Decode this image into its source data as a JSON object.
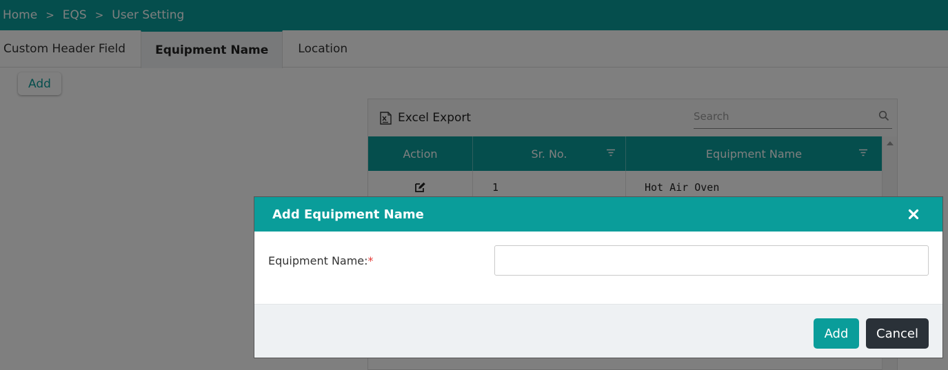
{
  "breadcrumb": [
    "Home",
    "EQS",
    "User Setting"
  ],
  "tabs": [
    {
      "label": "Custom Header Field"
    },
    {
      "label": "Equipment Name"
    },
    {
      "label": "Location"
    }
  ],
  "add_button_label": "Add",
  "grid": {
    "excel_export_label": "Excel Export",
    "search_placeholder": "Search",
    "columns": [
      "Action",
      "Sr. No.",
      "Equipment Name"
    ],
    "rows": [
      {
        "sr_no": "1",
        "equipment_name": "Hot Air Oven"
      }
    ]
  },
  "modal": {
    "title": "Add Equipment Name",
    "field_label": "Equipment Name:",
    "required_mark": "*",
    "field_value": "",
    "add_label": "Add",
    "cancel_label": "Cancel"
  },
  "colors": {
    "accent": "#0a9d9a",
    "dark_button": "#2a3138",
    "required": "#e53935"
  }
}
